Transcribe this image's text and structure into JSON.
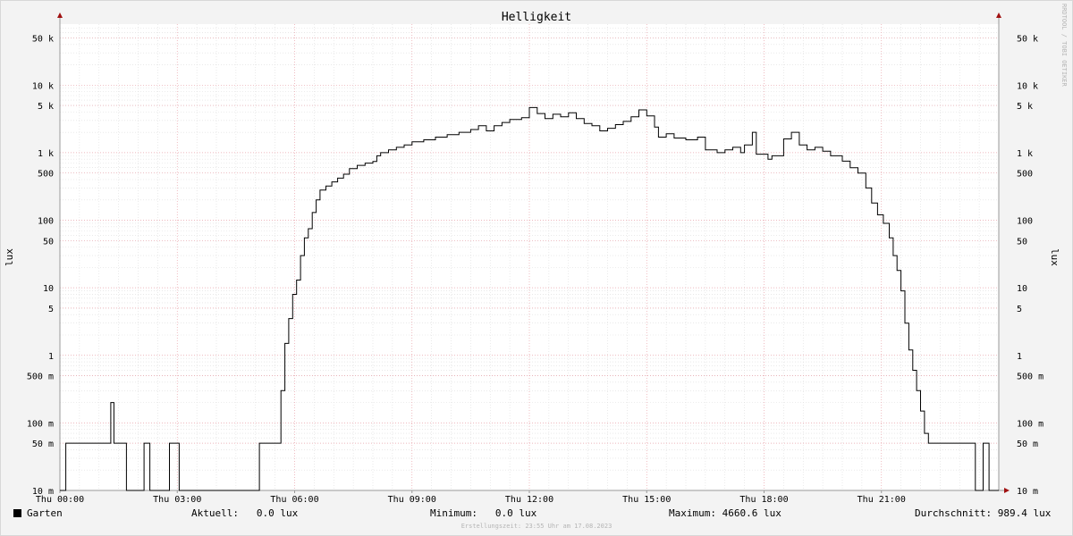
{
  "chart_data": {
    "type": "line",
    "title": "Helligkeit",
    "ylabel": "lux",
    "yscale": "log",
    "ylim": [
      0.01,
      80000
    ],
    "xlim": [
      0,
      24
    ],
    "x_ticks": [
      {
        "h": 0,
        "label": "Thu 00:00"
      },
      {
        "h": 3,
        "label": "Thu 03:00"
      },
      {
        "h": 6,
        "label": "Thu 06:00"
      },
      {
        "h": 9,
        "label": "Thu 09:00"
      },
      {
        "h": 12,
        "label": "Thu 12:00"
      },
      {
        "h": 15,
        "label": "Thu 15:00"
      },
      {
        "h": 18,
        "label": "Thu 18:00"
      },
      {
        "h": 21,
        "label": "Thu 21:00"
      }
    ],
    "y_ticks": [
      {
        "v": 50000,
        "label": "50 k"
      },
      {
        "v": 10000,
        "label": "10 k"
      },
      {
        "v": 5000,
        "label": "5 k"
      },
      {
        "v": 1000,
        "label": "1 k"
      },
      {
        "v": 500,
        "label": "500"
      },
      {
        "v": 100,
        "label": "100"
      },
      {
        "v": 50,
        "label": "50"
      },
      {
        "v": 10,
        "label": "10"
      },
      {
        "v": 5,
        "label": "5"
      },
      {
        "v": 1,
        "label": "1"
      },
      {
        "v": 0.5,
        "label": "500 m"
      },
      {
        "v": 0.1,
        "label": "100 m"
      },
      {
        "v": 0.05,
        "label": "50 m"
      },
      {
        "v": 0.01,
        "label": "10 m"
      }
    ],
    "grid": true,
    "series": [
      {
        "name": "Garten",
        "color": "#000000",
        "points": [
          [
            0.0,
            0.01
          ],
          [
            0.15,
            0.01
          ],
          [
            0.15,
            0.05
          ],
          [
            1.3,
            0.05
          ],
          [
            1.3,
            0.2
          ],
          [
            1.38,
            0.2
          ],
          [
            1.38,
            0.05
          ],
          [
            1.7,
            0.05
          ],
          [
            1.7,
            0.01
          ],
          [
            2.15,
            0.01
          ],
          [
            2.15,
            0.05
          ],
          [
            2.3,
            0.05
          ],
          [
            2.3,
            0.01
          ],
          [
            2.8,
            0.01
          ],
          [
            2.8,
            0.05
          ],
          [
            3.05,
            0.05
          ],
          [
            3.05,
            0.01
          ],
          [
            5.1,
            0.01
          ],
          [
            5.1,
            0.05
          ],
          [
            5.65,
            0.05
          ],
          [
            5.65,
            0.3
          ],
          [
            5.75,
            0.3
          ],
          [
            5.75,
            1.5
          ],
          [
            5.85,
            3.5
          ],
          [
            5.95,
            8
          ],
          [
            6.05,
            13
          ],
          [
            6.15,
            30
          ],
          [
            6.25,
            55
          ],
          [
            6.35,
            75
          ],
          [
            6.45,
            130
          ],
          [
            6.55,
            200
          ],
          [
            6.65,
            280
          ],
          [
            6.8,
            320
          ],
          [
            6.95,
            370
          ],
          [
            7.1,
            420
          ],
          [
            7.25,
            480
          ],
          [
            7.4,
            580
          ],
          [
            7.6,
            650
          ],
          [
            7.8,
            700
          ],
          [
            8.0,
            740
          ],
          [
            8.1,
            900
          ],
          [
            8.2,
            1000
          ],
          [
            8.4,
            1100
          ],
          [
            8.6,
            1200
          ],
          [
            8.8,
            1300
          ],
          [
            9.0,
            1450
          ],
          [
            9.3,
            1550
          ],
          [
            9.6,
            1700
          ],
          [
            9.9,
            1850
          ],
          [
            10.2,
            2000
          ],
          [
            10.5,
            2200
          ],
          [
            10.7,
            2500
          ],
          [
            10.9,
            2100
          ],
          [
            11.1,
            2500
          ],
          [
            11.3,
            2800
          ],
          [
            11.5,
            3100
          ],
          [
            11.8,
            3300
          ],
          [
            12.0,
            4660
          ],
          [
            12.2,
            3800
          ],
          [
            12.4,
            3200
          ],
          [
            12.6,
            3700
          ],
          [
            12.8,
            3400
          ],
          [
            13.0,
            3900
          ],
          [
            13.2,
            3200
          ],
          [
            13.4,
            2700
          ],
          [
            13.6,
            2500
          ],
          [
            13.8,
            2100
          ],
          [
            14.0,
            2300
          ],
          [
            14.2,
            2600
          ],
          [
            14.4,
            2900
          ],
          [
            14.6,
            3400
          ],
          [
            14.8,
            4300
          ],
          [
            15.0,
            3500
          ],
          [
            15.2,
            2400
          ],
          [
            15.3,
            1700
          ],
          [
            15.5,
            1900
          ],
          [
            15.7,
            1650
          ],
          [
            16.0,
            1550
          ],
          [
            16.3,
            1700
          ],
          [
            16.5,
            1100
          ],
          [
            16.8,
            1000
          ],
          [
            17.0,
            1100
          ],
          [
            17.2,
            1200
          ],
          [
            17.4,
            1000
          ],
          [
            17.5,
            1300
          ],
          [
            17.7,
            2000
          ],
          [
            17.8,
            950
          ],
          [
            18.1,
            800
          ],
          [
            18.2,
            900
          ],
          [
            18.35,
            900
          ],
          [
            18.5,
            1600
          ],
          [
            18.7,
            2000
          ],
          [
            18.9,
            1300
          ],
          [
            19.1,
            1100
          ],
          [
            19.3,
            1200
          ],
          [
            19.5,
            1050
          ],
          [
            19.7,
            900
          ],
          [
            20.0,
            750
          ],
          [
            20.2,
            600
          ],
          [
            20.4,
            500
          ],
          [
            20.6,
            300
          ],
          [
            20.75,
            180
          ],
          [
            20.9,
            120
          ],
          [
            21.05,
            90
          ],
          [
            21.2,
            55
          ],
          [
            21.3,
            30
          ],
          [
            21.4,
            18
          ],
          [
            21.5,
            9
          ],
          [
            21.6,
            3
          ],
          [
            21.7,
            1.2
          ],
          [
            21.8,
            0.6
          ],
          [
            21.9,
            0.3
          ],
          [
            22.0,
            0.15
          ],
          [
            22.1,
            0.07
          ],
          [
            22.2,
            0.05
          ],
          [
            23.4,
            0.05
          ],
          [
            23.4,
            0.01
          ],
          [
            23.6,
            0.01
          ],
          [
            23.6,
            0.05
          ],
          [
            23.75,
            0.05
          ],
          [
            23.75,
            0.01
          ],
          [
            24.0,
            0.01
          ]
        ]
      }
    ]
  },
  "watermark": "RRDTOOL / TOBI OETIKER",
  "legend": {
    "series_label": "Garten",
    "current": "Aktuell:   0.0 lux",
    "minimum": "Minimum:   0.0 lux",
    "maximum": "Maximum: 4660.6 lux",
    "average": "Durchschnitt: 989.4 lux"
  },
  "footer": "Erstellungszeit: 23:55 Uhr am 17.08.2023"
}
